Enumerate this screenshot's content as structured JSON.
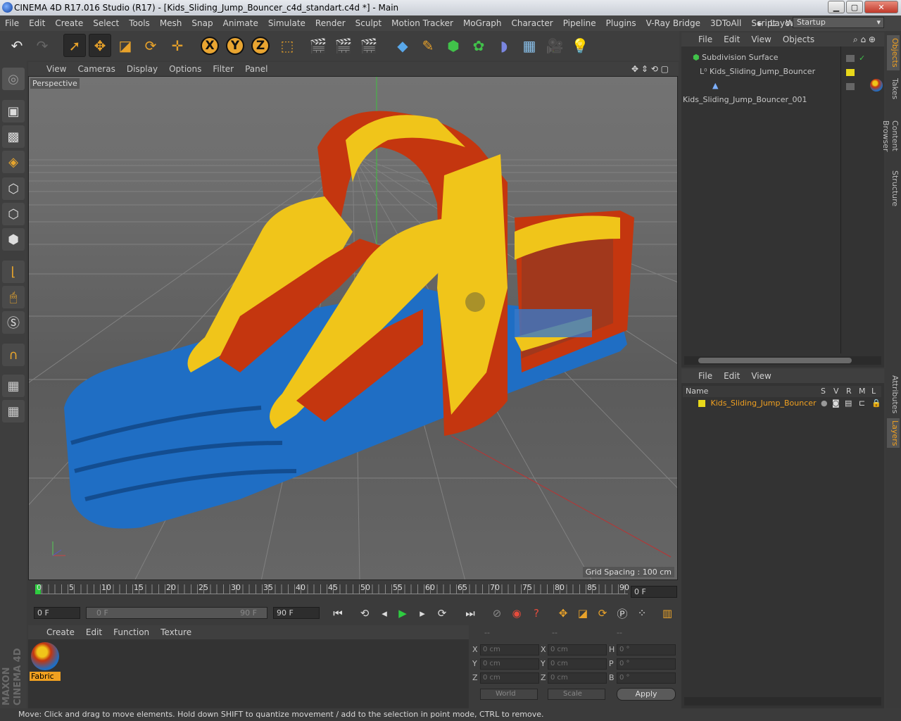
{
  "window": {
    "title": "CINEMA 4D R17.016 Studio (R17) - [Kids_Sliding_Jump_Bouncer_c4d_standart.c4d *] - Main",
    "min": "▁",
    "max": "▢",
    "close": "✕"
  },
  "menu": {
    "items": [
      "File",
      "Edit",
      "Create",
      "Select",
      "Tools",
      "Mesh",
      "Snap",
      "Animate",
      "Simulate",
      "Render",
      "Sculpt",
      "Motion Tracker",
      "MoGraph",
      "Character",
      "Pipeline",
      "Plugins",
      "V-Ray Bridge",
      "3DToAll",
      "Script",
      "Window"
    ],
    "layout_label": "Layout:",
    "layout_value": "Startup"
  },
  "toolbar": {
    "icons": [
      "undo-icon",
      "redo-icon",
      "select-icon",
      "move-icon",
      "scale-icon",
      "rotate-icon",
      "recent-tool-icon",
      "x-axis-icon",
      "y-axis-icon",
      "z-axis-icon",
      "world-coord-icon",
      "render-view-icon",
      "render-picture-queue-icon",
      "render-settings-icon",
      "cube-primitive-icon",
      "pen-spline-icon",
      "subdivision-icon",
      "mograph-cloner-icon",
      "deformer-icon",
      "floor-scene-icon",
      "camera-icon",
      "light-icon"
    ],
    "x": "X",
    "y": "Y",
    "z": "Z"
  },
  "viewport": {
    "menu": [
      "View",
      "Cameras",
      "Display",
      "Options",
      "Filter",
      "Panel"
    ],
    "label": "Perspective",
    "grid_spacing": "Grid Spacing : 100 cm",
    "colors": {
      "red": "#c4360f",
      "yellow": "#f0c51a",
      "blue": "#1f6ec4"
    }
  },
  "timeline": {
    "ticks": [
      "0",
      "5",
      "10",
      "15",
      "20",
      "25",
      "30",
      "35",
      "40",
      "45",
      "50",
      "55",
      "60",
      "65",
      "70",
      "75",
      "80",
      "85",
      "90"
    ],
    "current": "0 F"
  },
  "playback": {
    "start": "0 F",
    "range_start": "0 F",
    "range_end": "90 F",
    "end": "90 F"
  },
  "materials": {
    "menu": [
      "Create",
      "Edit",
      "Function",
      "Texture"
    ],
    "items": [
      {
        "name": "Fabric"
      }
    ]
  },
  "coords": {
    "header": [
      "--",
      "--",
      "--"
    ],
    "rows": [
      {
        "a": "X",
        "av": "0 cm",
        "b": "X",
        "bv": "0 cm",
        "c": "H",
        "cv": "0 °"
      },
      {
        "a": "Y",
        "av": "0 cm",
        "b": "Y",
        "bv": "0 cm",
        "c": "P",
        "cv": "0 °"
      },
      {
        "a": "Z",
        "av": "0 cm",
        "b": "Z",
        "bv": "0 cm",
        "c": "B",
        "cv": "0 °"
      }
    ],
    "mode1": "World",
    "mode2": "Scale",
    "apply": "Apply"
  },
  "objects": {
    "menu": [
      "File",
      "Edit",
      "View",
      "Objects"
    ],
    "items": [
      {
        "name": "Subdivision Surface"
      },
      {
        "name": "Kids_Sliding_Jump_Bouncer"
      },
      {
        "name": "Kids_Sliding_Jump_Bouncer_001"
      }
    ]
  },
  "layers": {
    "menu": [
      "File",
      "Edit",
      "View"
    ],
    "headers": [
      "Name",
      "S",
      "V",
      "R",
      "M",
      "L"
    ],
    "items": [
      {
        "name": "Kids_Sliding_Jump_Bouncer"
      }
    ]
  },
  "right_tabs": [
    "Objects",
    "Takes",
    "Content Browser",
    "Structure",
    "Attributes",
    "Layers"
  ],
  "brand": "MAXON CINEMA 4D",
  "status": "Move: Click and drag to move elements. Hold down SHIFT to quantize movement / add to the selection in point mode, CTRL to remove."
}
